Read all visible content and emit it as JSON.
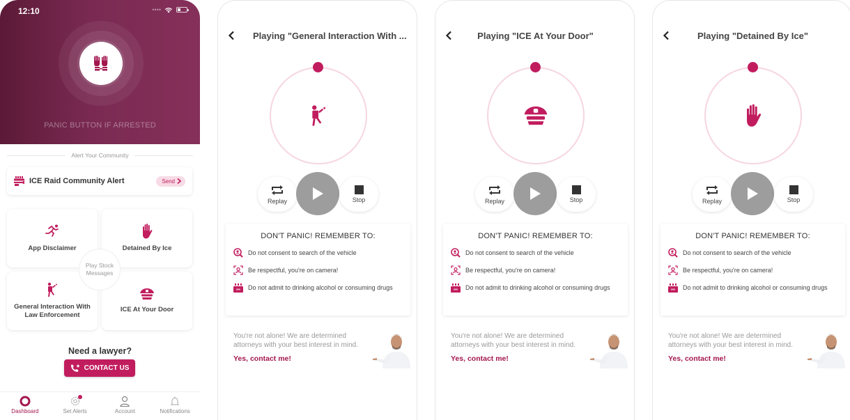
{
  "dashboard": {
    "status_time": "12:10",
    "panic_label": "PANIC BUTTON IF ARRESTED",
    "alert_section_label": "Alert Your Community",
    "alert_card_label": "ICE Raid Community Alert",
    "send_label": "Send",
    "tiles": [
      {
        "label": "App Disclaimer",
        "icon": "running-person-icon"
      },
      {
        "label": "Detained By Ice",
        "icon": "stop-hand-icon"
      },
      {
        "label": "General Interaction With Law Enforcement",
        "icon": "walking-person-icon"
      },
      {
        "label": "ICE At Your Door",
        "icon": "police-cap-icon"
      }
    ],
    "center_badge": "Play Stock Messages",
    "lawyer_question": "Need a lawyer?",
    "contact_button": "CONTACT US",
    "tabs": [
      {
        "label": "Dashboard",
        "icon": "dashboard-ring-icon",
        "active": true
      },
      {
        "label": "Set Alerts",
        "icon": "gear-icon",
        "badge": true
      },
      {
        "label": "Account",
        "icon": "user-icon"
      },
      {
        "label": "Notifications",
        "icon": "bell-icon"
      }
    ]
  },
  "player_common": {
    "replay_label": "Replay",
    "stop_label": "Stop",
    "tips_title": "DON'T PANIC! REMEMBER TO:",
    "tips": [
      {
        "icon": "search-person-icon",
        "text": "Do not consent to search of the vehicle"
      },
      {
        "icon": "camera-face-icon",
        "text": "Be respectful, you're on camera!"
      },
      {
        "icon": "no-drinks-icon",
        "text": "Do not admit to drinking alcohol or consuming drugs"
      }
    ],
    "promo_text": "You're not alone! We are determined attorneys with your best interest in mind.",
    "promo_link": "Yes, contact me!"
  },
  "players": [
    {
      "title": "Playing \"General Interaction With ...",
      "icon": "walking-person-icon"
    },
    {
      "title": "Playing \"ICE At Your Door\"",
      "icon": "police-cap-icon"
    },
    {
      "title": "Playing \"Detained By Ice\"",
      "icon": "stop-hand-icon"
    }
  ],
  "colors": {
    "brand": "#c11d5e",
    "brand_dark": "#7a2a52",
    "ring": "#f6d6e1",
    "play_button": "#9d9d9d"
  }
}
